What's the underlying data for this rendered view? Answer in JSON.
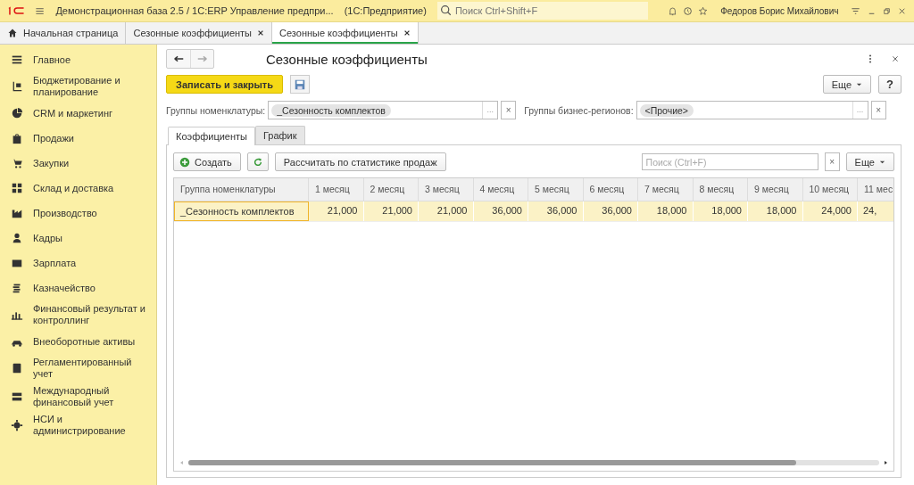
{
  "app_bar": {
    "title": "Демонстрационная база 2.5 / 1С:ERP Управление предпри...",
    "platform": "(1С:Предприятие)",
    "search": {
      "placeholder": "Поиск Ctrl+Shift+F"
    },
    "user": "Федоров Борис Михайлович"
  },
  "open_tabs": [
    {
      "label": "Начальная страница",
      "kind": "home",
      "selected": false
    },
    {
      "label": "Сезонные коэффициенты",
      "kind": "doc",
      "selected": false
    },
    {
      "label": "Сезонные коэффициенты",
      "kind": "doc",
      "selected": true
    }
  ],
  "sidebar": {
    "items": [
      {
        "label": "Главное"
      },
      {
        "label": "Бюджетирование и планирование"
      },
      {
        "label": "CRM и маркетинг"
      },
      {
        "label": "Продажи"
      },
      {
        "label": "Закупки"
      },
      {
        "label": "Склад и доставка"
      },
      {
        "label": "Производство"
      },
      {
        "label": "Кадры"
      },
      {
        "label": "Зарплата"
      },
      {
        "label": "Казначейство"
      },
      {
        "label": "Финансовый результат и контроллинг"
      },
      {
        "label": "Внеоборотные активы"
      },
      {
        "label": "Регламентированный учет"
      },
      {
        "label": "Международный финансовый учет"
      },
      {
        "label": "НСИ и администрирование"
      }
    ]
  },
  "form": {
    "title": "Сезонные коэффициенты",
    "save_close": "Записать и закрыть",
    "more": "Еще",
    "help": "?",
    "fields": [
      {
        "label": "Группы номенклатуры:",
        "value": "_Сезонность комплектов",
        "select": "...",
        "clear": "×"
      },
      {
        "label": "Группы бизнес-регионов:",
        "value": "<Прочие>",
        "select": "...",
        "clear": "×"
      }
    ],
    "tabs": [
      {
        "label": "Коэффициенты",
        "selected": true
      },
      {
        "label": "График",
        "selected": false
      }
    ],
    "toolbar": {
      "create": "Создать",
      "calculate": "Рассчитать по статистике продаж",
      "search": {
        "placeholder": "Поиск (Ctrl+F)"
      },
      "clear": "×",
      "more": "Еще"
    },
    "table": {
      "columns": [
        "Группа номенклатуры",
        "1 месяц",
        "2 месяц",
        "3 месяц",
        "4 месяц",
        "5 месяц",
        "6 месяц",
        "7 месяц",
        "8 месяц",
        "9 месяц",
        "10 месяц",
        "11 мес"
      ],
      "rows": [
        {
          "selected": true,
          "cells": [
            "_Сезонность комплектов",
            "21,000",
            "21,000",
            "21,000",
            "36,000",
            "36,000",
            "36,000",
            "18,000",
            "18,000",
            "18,000",
            "24,000",
            "24,"
          ]
        }
      ]
    }
  }
}
